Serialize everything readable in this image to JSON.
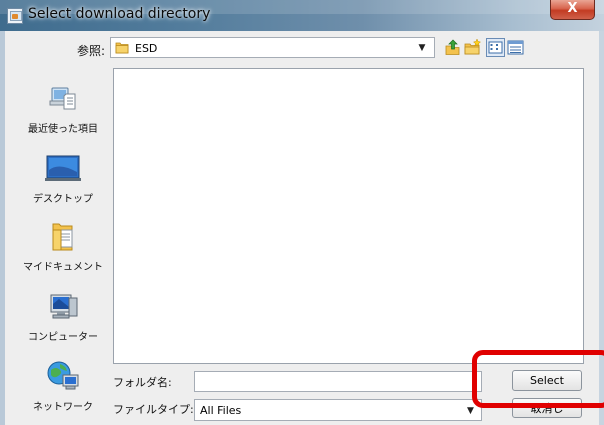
{
  "window": {
    "title": "Select download directory",
    "close_glyph": "X",
    "icon": "java-app-icon"
  },
  "toolbar": {
    "look_in_label": "参照:",
    "look_in_value": "ESD",
    "look_in_icon": "folder-icon",
    "buttons": [
      {
        "name": "up-folder-icon"
      },
      {
        "name": "new-folder-icon"
      },
      {
        "name": "list-view-icon"
      },
      {
        "name": "details-view-icon"
      }
    ]
  },
  "places": [
    {
      "label": "最近使った項目",
      "icon": "recent-items-icon"
    },
    {
      "label": "デスクトップ",
      "icon": "desktop-icon"
    },
    {
      "label": "マイドキュメント",
      "icon": "my-documents-icon"
    },
    {
      "label": "コンピューター",
      "icon": "computer-icon"
    },
    {
      "label": "ネットワーク",
      "icon": "network-icon"
    }
  ],
  "file_list": {
    "items": []
  },
  "form": {
    "folder_name_label": "フォルダ名:",
    "folder_name_value": "",
    "file_type_label": "ファイルタイプ:",
    "file_type_value": "All Files"
  },
  "buttons": {
    "select_label": "Select",
    "cancel_label": "取消し"
  },
  "annotation": {
    "highlight_color": "#e00000"
  },
  "colors": {
    "title_bar_start": "#3f6c8e",
    "close_button": "#c23b22",
    "content_bg": "#eeeeee"
  }
}
